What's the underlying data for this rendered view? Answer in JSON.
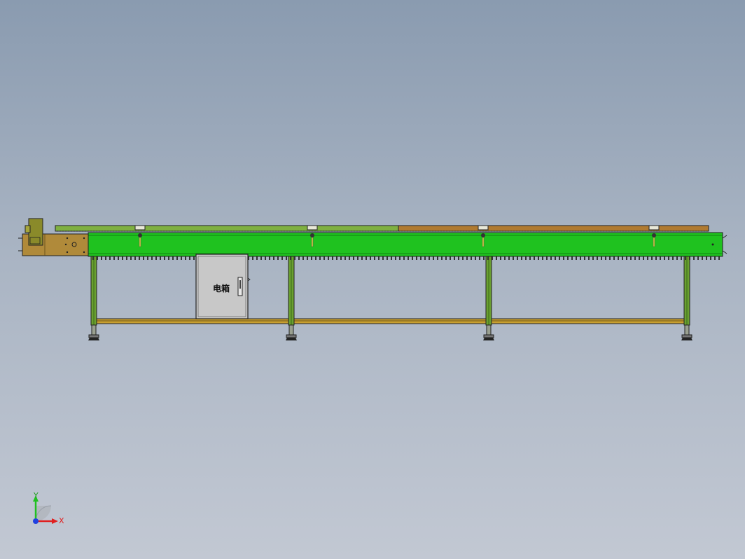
{
  "model": {
    "cabinet_label": "电箱"
  },
  "triad": {
    "x_label": "X",
    "y_label": "Y",
    "colors": {
      "x": "#e02020",
      "y": "#20c020",
      "z": "#2040e0"
    }
  },
  "colors": {
    "background_top": "#8a9bb0",
    "background_bottom": "#c2c8d3",
    "conveyor_body": "#1fc21f",
    "drive_housing": "#b08a3a",
    "belt_left": "#7fb040",
    "belt_right": "#b07a30",
    "legs": "#6aa030",
    "stretcher": "#c9a030",
    "cabinet": "#c8c8c8"
  }
}
